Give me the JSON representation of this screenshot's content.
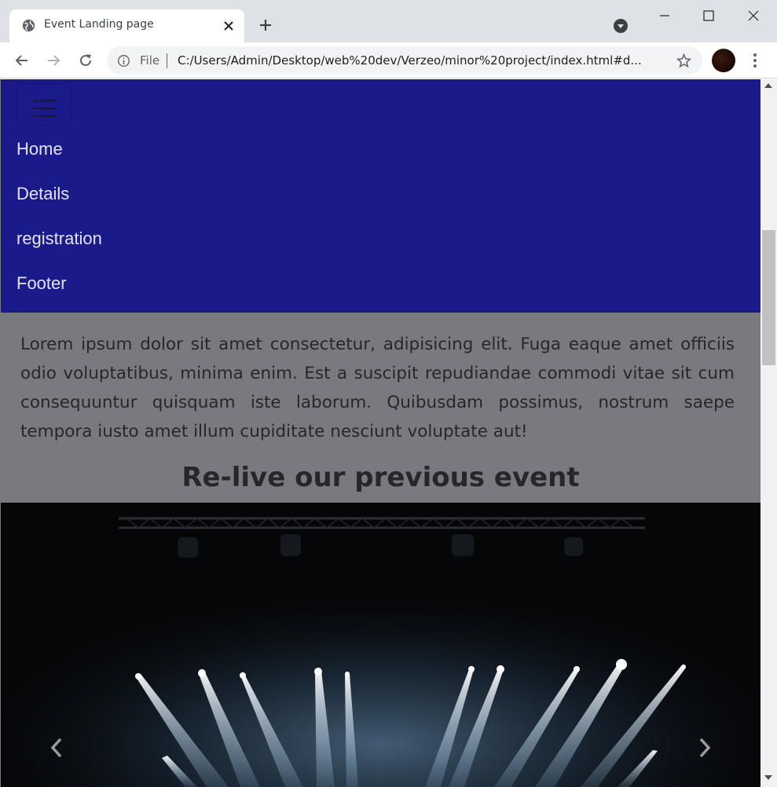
{
  "browser": {
    "tab_title": "Event Landing page",
    "address_scheme_label": "File",
    "url": "C:/Users/Admin/Desktop/web%20dev/Verzeo/minor%20project/index.html#d..."
  },
  "page": {
    "nav_links": [
      {
        "label": "Home"
      },
      {
        "label": "Details"
      },
      {
        "label": "registration"
      },
      {
        "label": "Footer"
      }
    ],
    "paragraph": "Lorem ipsum dolor sit amet consectetur, adipisicing elit. Fuga eaque amet officiis odio voluptatibus, minima enim. Est a suscipit repudiandae commodi vitae sit cum consequuntur quisquam iste laborum. Quibusdam possimus, nostrum saepe tempora iusto amet illum cupiditate nesciunt voluptate aut!",
    "heading": "Re-live our previous event"
  },
  "colors": {
    "navbar_bg": "#1a1a8a",
    "overlay_bg": "#797a7f",
    "text_dark": "#26272b"
  },
  "icons": [
    "globe-icon",
    "close-icon",
    "plus-icon",
    "back-icon",
    "forward-icon",
    "reload-icon",
    "info-icon",
    "star-icon",
    "kebab-menu-icon",
    "hamburger-icon",
    "chevron-left-icon",
    "chevron-right-icon"
  ]
}
